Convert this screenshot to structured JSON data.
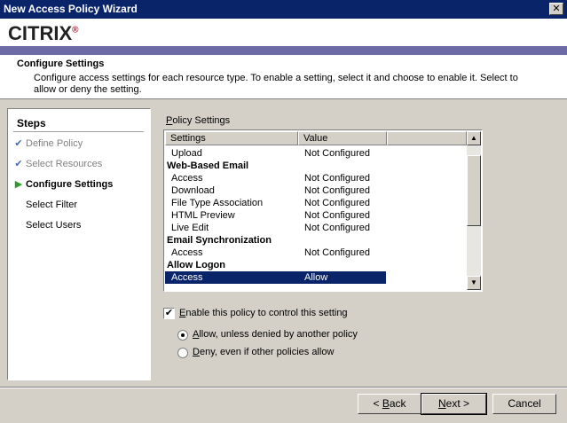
{
  "window": {
    "title": "New Access Policy Wizard",
    "close_glyph": "✕"
  },
  "brand": {
    "logo_text": "CITRIX",
    "logo_mark": "®",
    "bar_color": "#6e6aa6"
  },
  "header": {
    "title": "Configure Settings",
    "description": "Configure access settings for each resource type. To enable a setting, select it and choose to enable it. Select to allow or deny the setting."
  },
  "steps": {
    "title": "Steps",
    "items": [
      {
        "label": "Define Policy",
        "state": "done",
        "icon": "check-icon",
        "mark": "✔"
      },
      {
        "label": "Select Resources",
        "state": "done",
        "icon": "check-icon",
        "mark": "✔"
      },
      {
        "label": "Configure Settings",
        "state": "current",
        "icon": "arrow-right-icon",
        "mark": "▶"
      },
      {
        "label": "Select Filter",
        "state": "pending",
        "icon": "",
        "mark": ""
      },
      {
        "label": "Select Users",
        "state": "pending",
        "icon": "",
        "mark": ""
      }
    ]
  },
  "policy": {
    "label_accel": "P",
    "label_rest": "olicy Settings",
    "columns": [
      "Settings",
      "Value"
    ],
    "rows": [
      {
        "type": "item",
        "setting": "Upload",
        "value": "Not Configured"
      },
      {
        "type": "group",
        "setting": "Web-Based Email",
        "value": ""
      },
      {
        "type": "item",
        "setting": "Access",
        "value": "Not Configured"
      },
      {
        "type": "item",
        "setting": "Download",
        "value": "Not Configured"
      },
      {
        "type": "item",
        "setting": "File Type Association",
        "value": "Not Configured"
      },
      {
        "type": "item",
        "setting": "HTML Preview",
        "value": "Not Configured"
      },
      {
        "type": "item",
        "setting": "Live Edit",
        "value": "Not Configured"
      },
      {
        "type": "group",
        "setting": "Email Synchronization",
        "value": ""
      },
      {
        "type": "item",
        "setting": "Access",
        "value": "Not Configured"
      },
      {
        "type": "group",
        "setting": "Allow Logon",
        "value": ""
      },
      {
        "type": "item",
        "setting": "Access",
        "value": "Allow",
        "selected": true
      }
    ],
    "scroll_up_glyph": "▲",
    "scroll_down_glyph": "▼"
  },
  "options": {
    "enable_checked": true,
    "enable_label_accel": "E",
    "enable_label_rest": "nable this policy to control this setting",
    "check_glyph": "✔",
    "radios": [
      {
        "accel": "A",
        "rest": "llow, unless denied by another policy",
        "checked": true
      },
      {
        "accel": "D",
        "rest": "eny, even if other policies allow",
        "checked": false
      }
    ]
  },
  "buttons": {
    "back_prefix": "< ",
    "back_accel": "B",
    "back_rest": "ack",
    "next_accel": "N",
    "next_rest": "ext >",
    "cancel": "Cancel"
  }
}
